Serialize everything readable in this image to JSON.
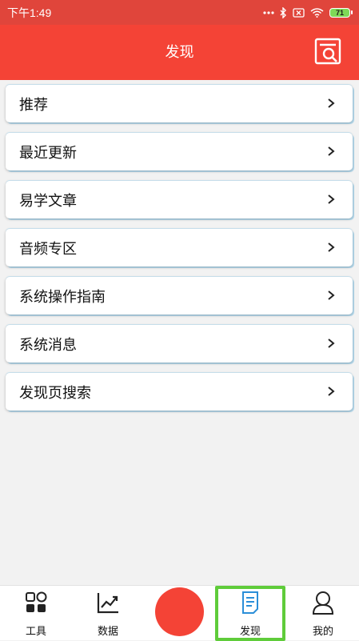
{
  "status_bar": {
    "time": "下午1:49",
    "battery": "71"
  },
  "header": {
    "title": "发现"
  },
  "menu": {
    "items": [
      {
        "label": "推荐"
      },
      {
        "label": "最近更新"
      },
      {
        "label": "易学文章"
      },
      {
        "label": "音频专区"
      },
      {
        "label": "系统操作指南"
      },
      {
        "label": "系统消息"
      },
      {
        "label": "发现页搜索"
      }
    ]
  },
  "bottom_nav": {
    "items": [
      {
        "label": "工具",
        "icon": "apps-grid-icon"
      },
      {
        "label": "数据",
        "icon": "trend-chart-icon"
      },
      {
        "label": "发现",
        "icon": "document-icon",
        "active": true
      },
      {
        "label": "我的",
        "icon": "user-icon"
      }
    ]
  },
  "colors": {
    "header_red": "#f44336",
    "status_red": "#e0453b",
    "active_blue": "#2a8ed8",
    "highlight_green": "#5fcc3a"
  }
}
